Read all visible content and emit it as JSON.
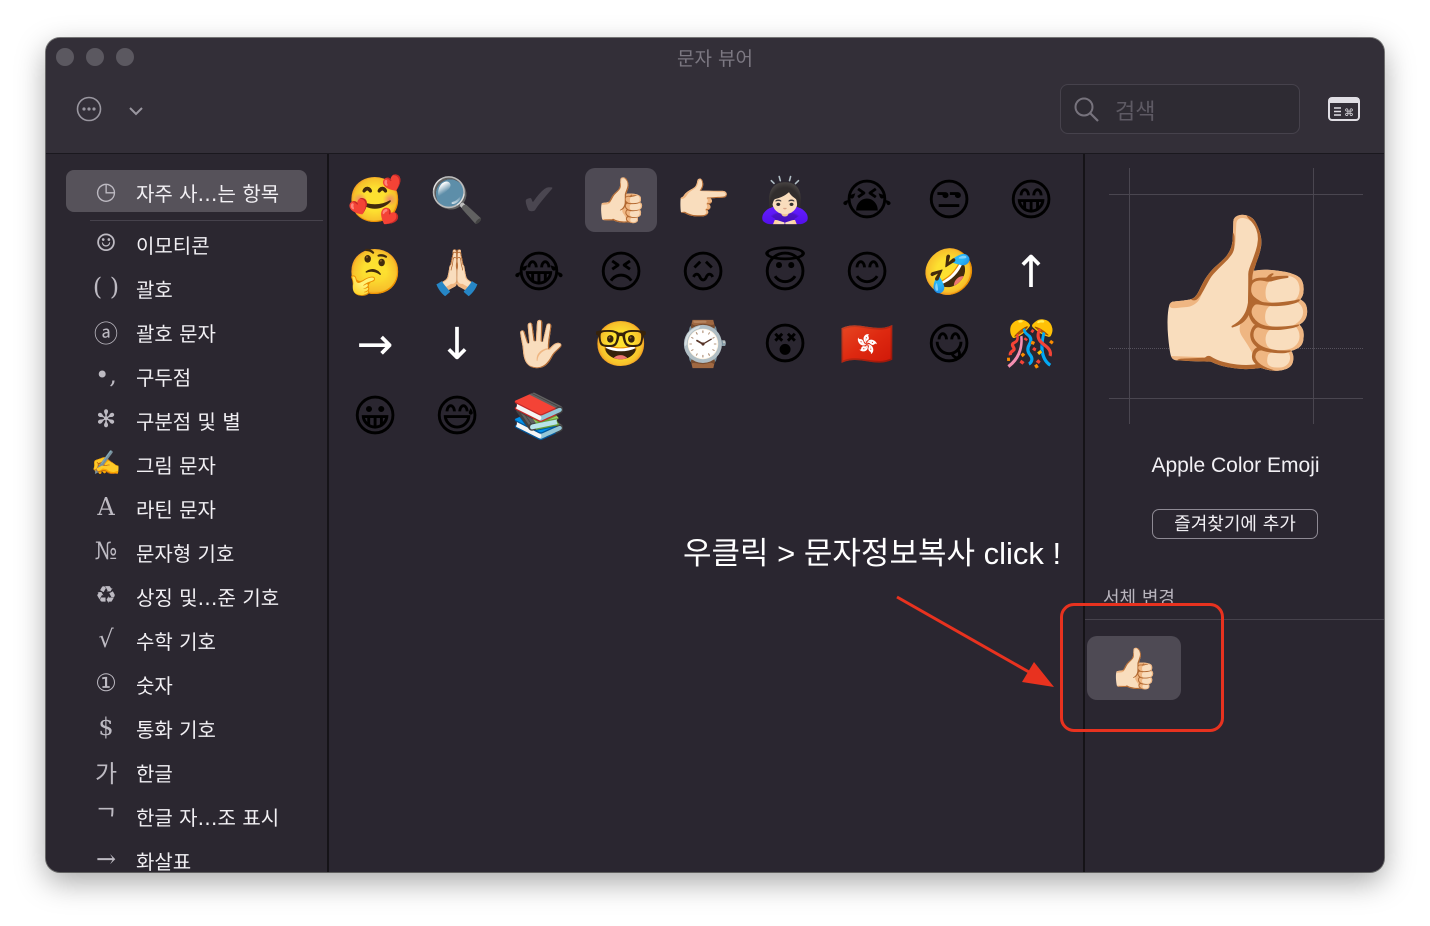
{
  "window": {
    "title": "문자 뷰어"
  },
  "toolbar": {
    "search_placeholder": "검색"
  },
  "sidebar": {
    "items": [
      {
        "icon": "clock-icon",
        "glyph": "◷",
        "label": "자주 사…는 항목",
        "selected": true
      },
      {
        "icon": "smiley-icon",
        "glyph": "☺",
        "label": "이모티콘"
      },
      {
        "icon": "parentheses-icon",
        "glyph": "( )",
        "label": "괄호"
      },
      {
        "icon": "circled-a-icon",
        "glyph": "ⓐ",
        "label": "괄호 문자"
      },
      {
        "icon": "punctuation-icon",
        "glyph": "•,",
        "label": "구두점"
      },
      {
        "icon": "asterisk-icon",
        "glyph": "✻",
        "label": "구분점 및 별"
      },
      {
        "icon": "writing-hand-icon",
        "glyph": "✍",
        "label": "그림 문자"
      },
      {
        "icon": "latin-a-icon",
        "glyph": "A",
        "label": "라틴 문자"
      },
      {
        "icon": "numero-icon",
        "glyph": "№",
        "label": "문자형 기호"
      },
      {
        "icon": "recycle-icon",
        "glyph": "♻",
        "label": "상징 및…준 기호"
      },
      {
        "icon": "square-root-icon",
        "glyph": "√",
        "label": "수학 기호"
      },
      {
        "icon": "circled-one-icon",
        "glyph": "①",
        "label": "숫자"
      },
      {
        "icon": "dollar-icon",
        "glyph": "$",
        "label": "통화 기호"
      },
      {
        "icon": "hangul-ga-icon",
        "glyph": "가",
        "label": "한글"
      },
      {
        "icon": "hangul-jamo-icon",
        "glyph": "ᄀ",
        "label": "한글 자…조 표시"
      },
      {
        "icon": "arrow-right-icon",
        "glyph": "→",
        "label": "화살표"
      }
    ]
  },
  "emoji_grid": {
    "items": [
      "🥰",
      "🔍",
      "✔",
      "👍🏻",
      "👉🏻",
      "🙇🏻‍♀️",
      "😭",
      "😒",
      "😁",
      "🤔",
      "🙏🏻",
      "😂",
      "😣",
      "😖",
      "😇",
      "😊",
      "🤣",
      "↑",
      "→",
      "↓",
      "🖐🏻",
      "🤓",
      "⌚",
      "😵",
      "🇭🇰",
      "😋",
      "🎊",
      "😀",
      "😅",
      "📚"
    ],
    "selected_index": 3
  },
  "detail": {
    "preview_char": "👍🏻",
    "font_name": "Apple Color Emoji",
    "favorite_button": "즐겨찾기에 추가",
    "font_variation_label": "서체 변경",
    "variant_char": "👍🏻"
  },
  "annotation": {
    "text": "우클릭 > 문자정보복사 click !",
    "color": "#e8321f"
  }
}
